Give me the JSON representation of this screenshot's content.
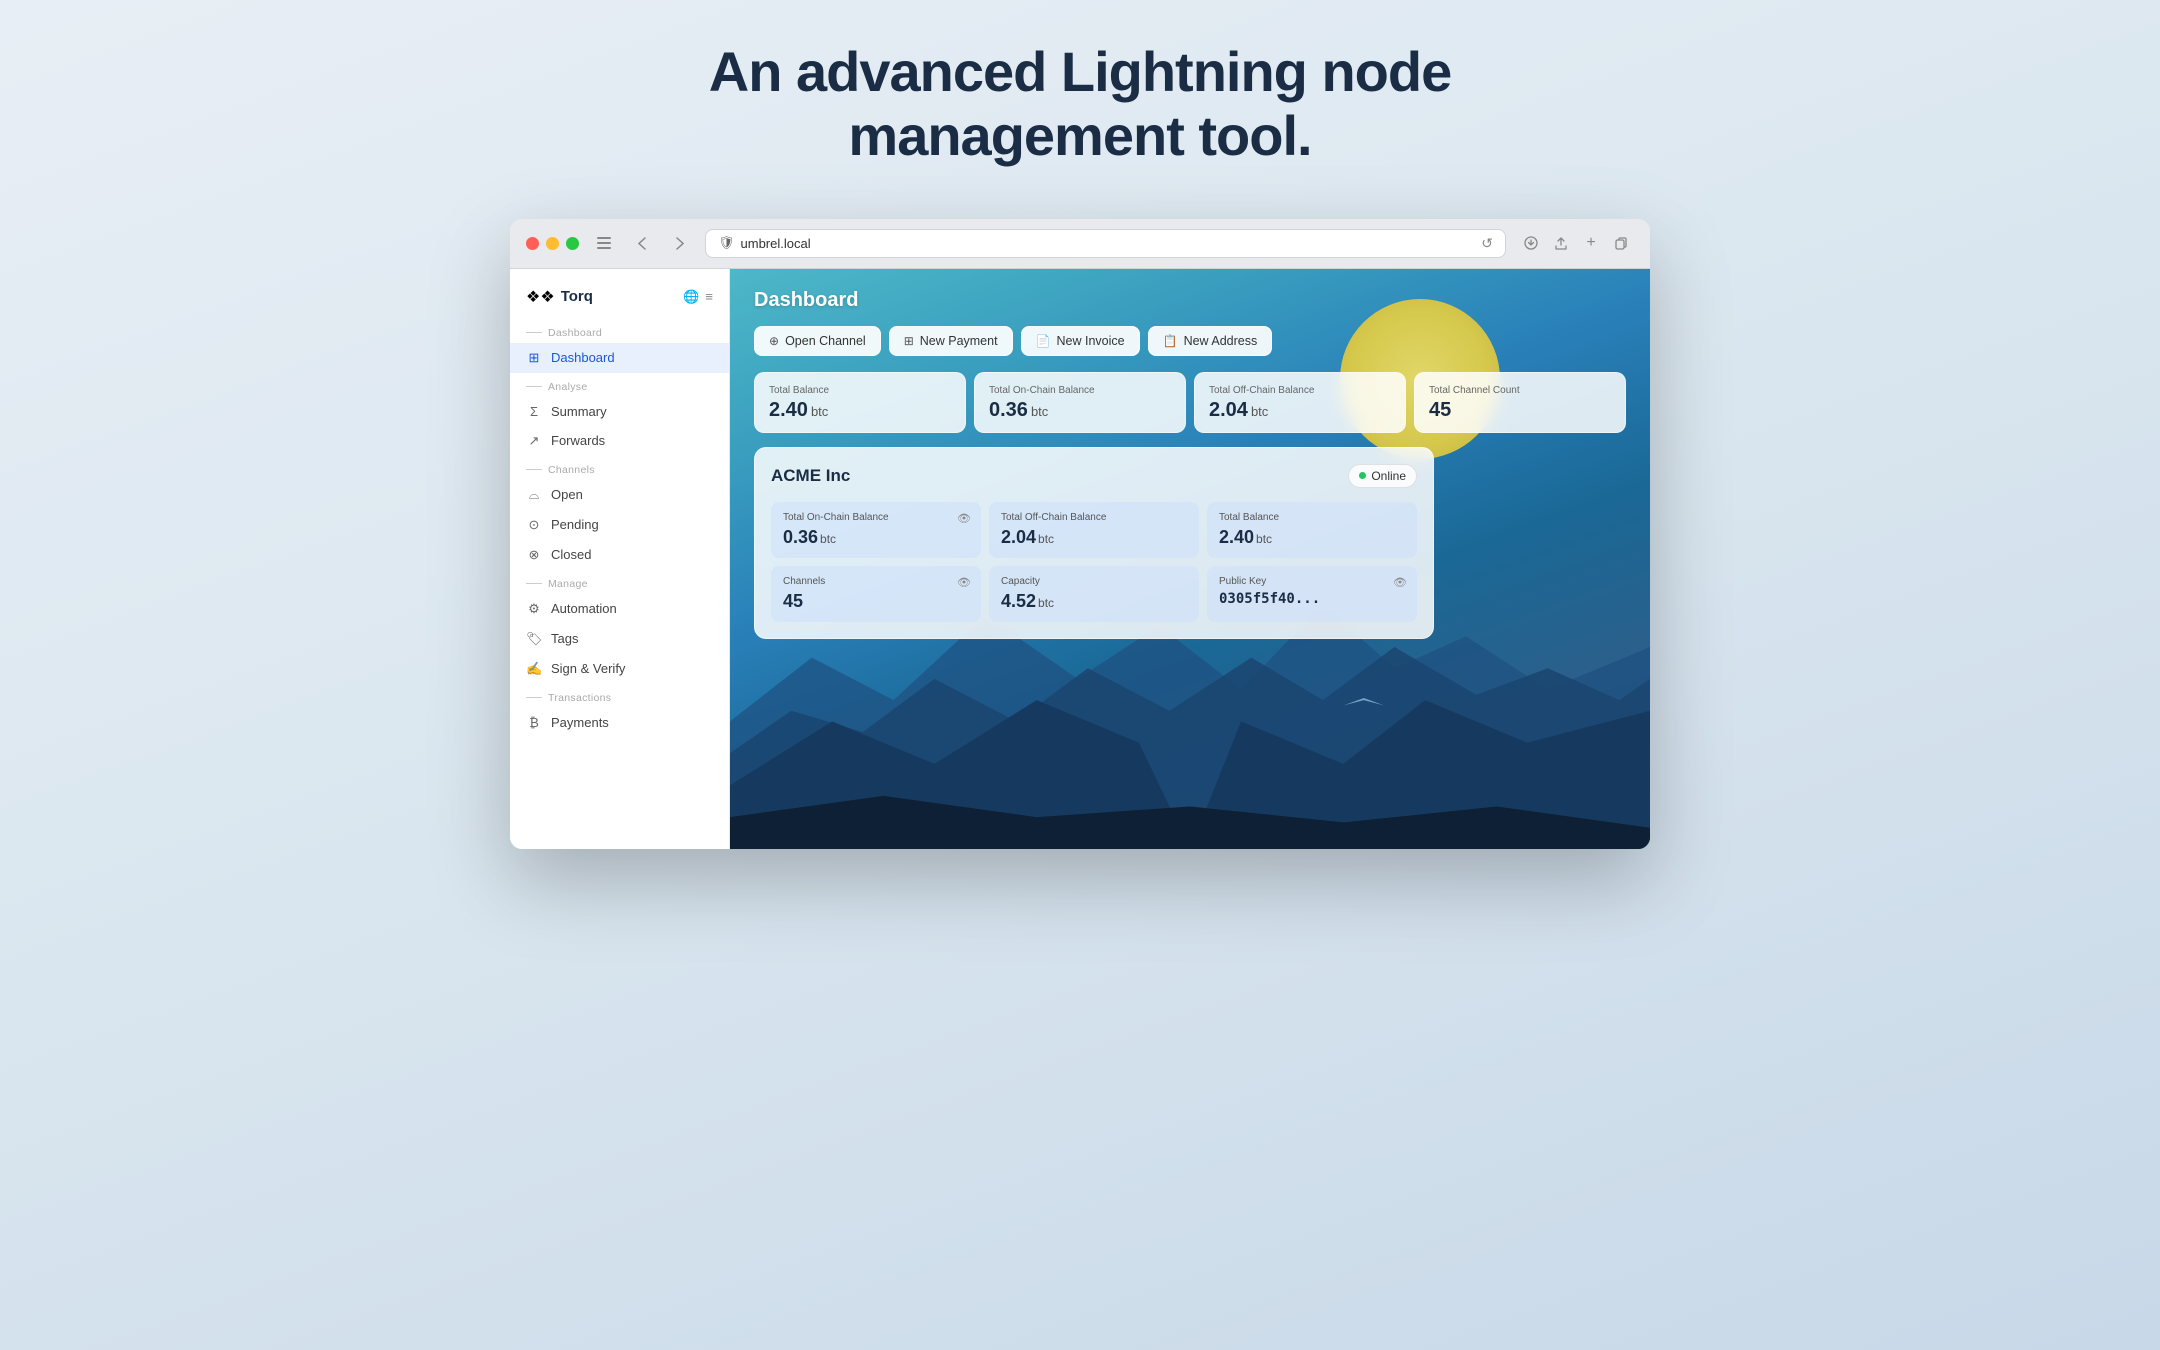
{
  "page": {
    "hero_title_line1": "An advanced Lightning node",
    "hero_title_line2": "management tool."
  },
  "browser": {
    "url": "umbrel.local",
    "shield_icon": "🛡",
    "reload_icon": "↺"
  },
  "app": {
    "logo": "Torq",
    "logo_icon": "❖"
  },
  "sidebar": {
    "section_dashboard": "Dashboard",
    "item_dashboard": "Dashboard",
    "section_analyse": "Analyse",
    "item_summary": "Summary",
    "item_forwards": "Forwards",
    "section_channels": "Channels",
    "item_open": "Open",
    "item_pending": "Pending",
    "item_closed": "Closed",
    "section_manage": "Manage",
    "item_automation": "Automation",
    "item_tags": "Tags",
    "item_sign_verify": "Sign & Verify",
    "section_transactions": "Transactions",
    "item_payments": "Payments"
  },
  "dashboard": {
    "title": "Dashboard",
    "buttons": {
      "open_channel": "Open Channel",
      "new_payment": "New Payment",
      "new_invoice": "New Invoice",
      "new_address": "New Address"
    },
    "stats": {
      "total_balance_label": "Total Balance",
      "total_balance_value": "2.40",
      "total_balance_unit": "btc",
      "total_on_chain_label": "Total On-Chain Balance",
      "total_on_chain_value": "0.36",
      "total_on_chain_unit": "btc",
      "total_off_chain_label": "Total Off-Chain Balance",
      "total_off_chain_value": "2.04",
      "total_off_chain_unit": "btc",
      "total_channel_count_label": "Total Channel Count",
      "total_channel_count_value": "45"
    },
    "node": {
      "name": "ACME Inc",
      "status": "Online",
      "on_chain_label": "Total On-Chain Balance",
      "on_chain_value": "0.36",
      "on_chain_unit": "btc",
      "off_chain_label": "Total Off-Chain Balance",
      "off_chain_value": "2.04",
      "off_chain_unit": "btc",
      "balance_label": "Total Balance",
      "balance_value": "2.40",
      "balance_unit": "btc",
      "channels_label": "Channels",
      "channels_value": "45",
      "capacity_label": "Capacity",
      "capacity_value": "4.52",
      "capacity_unit": "btc",
      "public_key_label": "Public Key",
      "public_key_value": "0305f5f40..."
    }
  }
}
